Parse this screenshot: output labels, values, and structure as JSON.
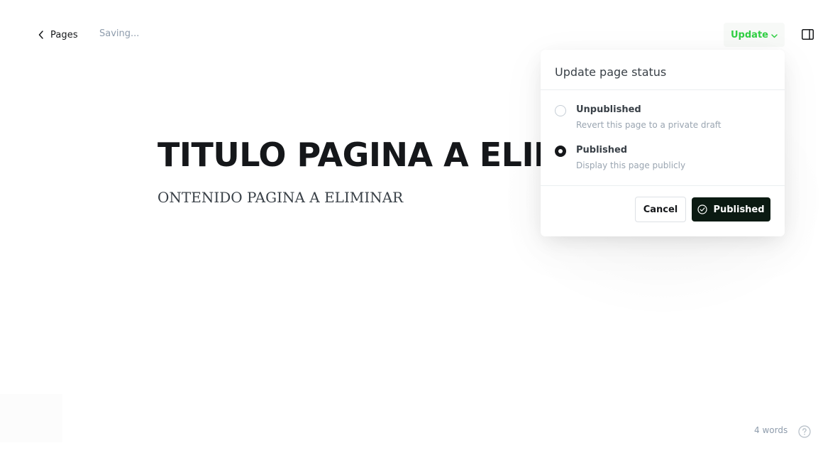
{
  "header": {
    "back_label": "Pages",
    "back_icon": "chevron-left-icon",
    "saving_status": "Saving...",
    "update_label": "Update",
    "update_icon": "chevron-down-icon",
    "update_color": "#30cf43",
    "sidebar_toggle_icon": "sidebar-panel-icon"
  },
  "editor": {
    "title": "TITULO PAGINA A ELIMINAR",
    "content": "ONTENIDO PAGINA A ELIMINAR"
  },
  "popover": {
    "title": "Update page status",
    "options": [
      {
        "label": "Unpublished",
        "description": "Revert this page to a private draft",
        "selected": false
      },
      {
        "label": "Published",
        "description": "Display this page publicly",
        "selected": true
      }
    ],
    "cancel_label": "Cancel",
    "confirm_label": "Published",
    "confirm_icon": "check-circle-icon",
    "confirm_color": "#0b1a12"
  },
  "footer": {
    "word_count": "4 words",
    "help_icon": "help-circle-icon"
  }
}
